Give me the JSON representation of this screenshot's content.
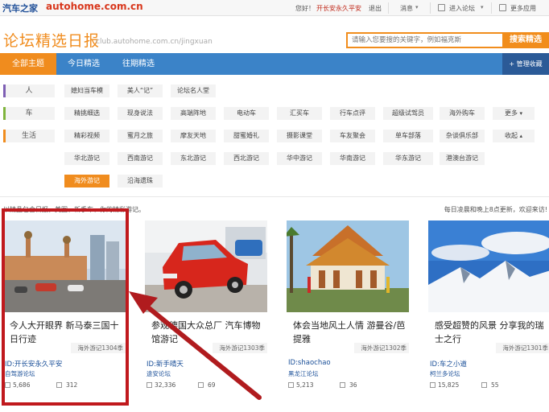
{
  "topbar": {
    "logo_text": "汽车之家",
    "logo_url": "autohome.com.cn",
    "greeting": "您好！",
    "username": "开长安永久平安",
    "logout": "退出",
    "messages": "消息",
    "enter_forum": "进入论坛",
    "more_apps": "更多应用"
  },
  "header": {
    "title": "论坛精选日报",
    "subtitle": "club.autohome.com.cn/jingxuan",
    "search_placeholder": "请输入您要搜的关键字，例如福克斯",
    "search_button": "搜索精选"
  },
  "nav": {
    "tabs": [
      "全部主题",
      "今日精选",
      "往期精选"
    ],
    "manage": "+ 管理收藏"
  },
  "categories": [
    {
      "label": "人",
      "color": "#7e5fb4"
    },
    {
      "label": "车",
      "color": "#7fb43c"
    },
    {
      "label": "生活",
      "color": "#f08c1e"
    }
  ],
  "tags": {
    "row1": [
      "媳妇当车模",
      "美人“记”",
      "论坛名人堂"
    ],
    "row2": [
      "精挑细选",
      "现身说法",
      "高端阵地",
      "电动车",
      "汇买车",
      "行车点评",
      "超级试驾员",
      "海外购车",
      "更多"
    ],
    "row3": [
      "精彩视频",
      "蜜月之旅",
      "摩友天地",
      "甜蜜婚礼",
      "摄影课堂",
      "车友聚会",
      "单车部落",
      "杂谈俱乐部",
      "收起"
    ],
    "row4": [
      "华北游记",
      "西南游记",
      "东北游记",
      "西北游记",
      "华中游记",
      "华南游记",
      "华东游记",
      "港澳台游记"
    ],
    "row5": [
      "海外游记",
      "沿海遗珠"
    ]
  },
  "notice": {
    "left": "以精品包含日报，美图、新手车、你的精彩游记。",
    "right": "每日凌晨和晚上8点更新，欢迎来访!"
  },
  "cards": [
    {
      "title": "今人大开眼界 新马泰三国十日行迹",
      "ribbon": "海外游记1304季",
      "id": "ID:开长安永久平安",
      "forum": "自驾游论坛",
      "views": "5,686",
      "replies": "312"
    },
    {
      "title": "参观德国大众总厂 汽车博物馆游记",
      "ribbon": "海外游记1303季",
      "id": "ID:新手晴天",
      "forum": "途安论坛",
      "views": "32,336",
      "replies": "69"
    },
    {
      "title": "体会当地风土人情 游曼谷/芭提雅",
      "ribbon": "海外游记1302季",
      "id": "ID:shaochao",
      "forum": "黑龙江论坛",
      "views": "5,213",
      "replies": "36"
    },
    {
      "title": "感受超赞的风景 分享我的瑞士之行",
      "ribbon": "海外游记1301季",
      "id": "ID:车之小道",
      "forum": "柯兰多论坛",
      "views": "15,825",
      "replies": "55"
    }
  ],
  "colors": {
    "accent": "#f08c1e",
    "nav": "#3b83c8",
    "highlight": "#c0191d"
  }
}
